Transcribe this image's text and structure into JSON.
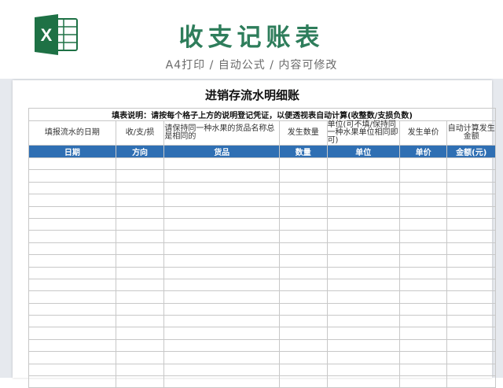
{
  "header": {
    "title": "收支记账表",
    "subtitle": "A4打印 / 自动公式 / 内容可修改"
  },
  "colors": {
    "brand_green": "#2e7d5b",
    "header_blue": "#2f6fb3",
    "excel_green": "#1e7145"
  },
  "logo": {
    "icon": "excel-icon",
    "letter": "X"
  },
  "sheet": {
    "title": "进销存流水明细账",
    "note": "填表说明：请按每个格子上方的说明登记凭证，以便透视表自动计算(收整数/支损负数)",
    "descriptions": [
      "填报流水的日期",
      "收/支/损",
      "请保持同一种水果的货品名称总是相同的",
      "发生数量",
      "单位(可不填/保持同一种水果单位相同即可)",
      "发生单价",
      "自动计算发生金额"
    ],
    "columns": [
      "日期",
      "方向",
      "货品",
      "数量",
      "单位",
      "单价",
      "金额(元)"
    ]
  }
}
